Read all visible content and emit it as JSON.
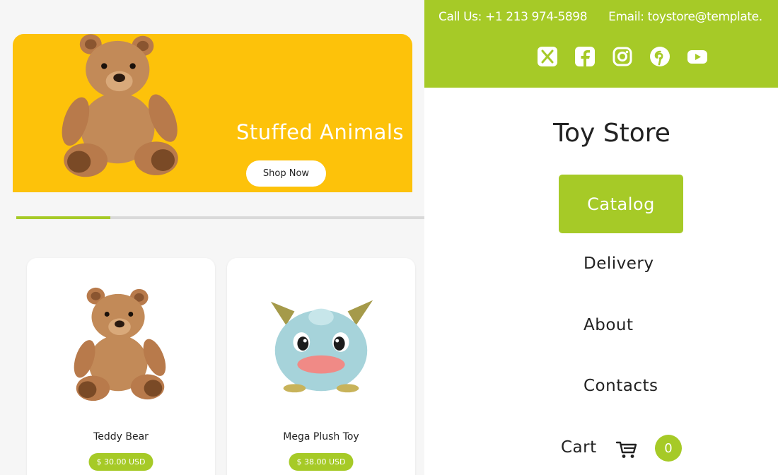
{
  "banner": {
    "title": "Stuffed Animals",
    "button_label": "Shop Now",
    "background_color": "#fdc20a"
  },
  "slider": {
    "progress": 0.23
  },
  "products": [
    {
      "name": "Teddy Bear",
      "price": "$ 30.00 USD",
      "image": "teddy-bear"
    },
    {
      "name": "Mega Plush Toy",
      "price": "$ 38.00 USD",
      "image": "plush-monster"
    }
  ],
  "topbar": {
    "phone": "Call Us: +1 213 974-5898",
    "email": "Email: toystore@template.",
    "socials": [
      "x-icon",
      "facebook-icon",
      "instagram-icon",
      "pinterest-icon",
      "youtube-icon"
    ],
    "color": "#a6ca27"
  },
  "brand": "Toy Store",
  "nav": {
    "catalog": "Catalog",
    "delivery": "Delivery",
    "about": "About",
    "contacts": "Contacts",
    "cart": "Cart",
    "cart_count": "0"
  }
}
